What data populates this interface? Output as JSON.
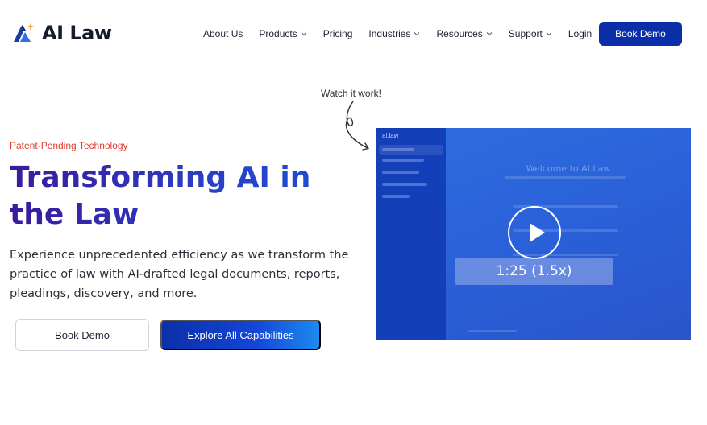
{
  "brand": {
    "name": "AI Law",
    "logo_icon": "ai-law-logo-icon",
    "accent": "#0b2fa8",
    "spark": "#f2a33a"
  },
  "nav": {
    "items": [
      {
        "label": "About Us",
        "dropdown": false
      },
      {
        "label": "Products",
        "dropdown": true
      },
      {
        "label": "Pricing",
        "dropdown": false
      },
      {
        "label": "Industries",
        "dropdown": true
      },
      {
        "label": "Resources",
        "dropdown": true
      },
      {
        "label": "Support",
        "dropdown": true
      },
      {
        "label": "Login",
        "dropdown": false
      }
    ],
    "cta": "Book Demo"
  },
  "hero": {
    "watch_label": "Watch it work!",
    "eyebrow": "Patent-Pending Technology",
    "headline": "Transforming AI in the Law",
    "subtext": "Experience unprecedented efficiency as we transform the practice of law with AI-drafted legal documents, reports, pleadings, discovery, and more.",
    "buttons": {
      "secondary": "Book Demo",
      "primary": "Explore All Capabilities"
    }
  },
  "video": {
    "brand": "ai.law",
    "title": "Welcome to AI.Law",
    "speed_overlay": "1:25 (1.5x)",
    "play_icon": "play-icon"
  },
  "colors": {
    "eyebrow": "#e23b2e",
    "headline_start": "#3b1a9c",
    "headline_end": "#1b4fd8"
  }
}
